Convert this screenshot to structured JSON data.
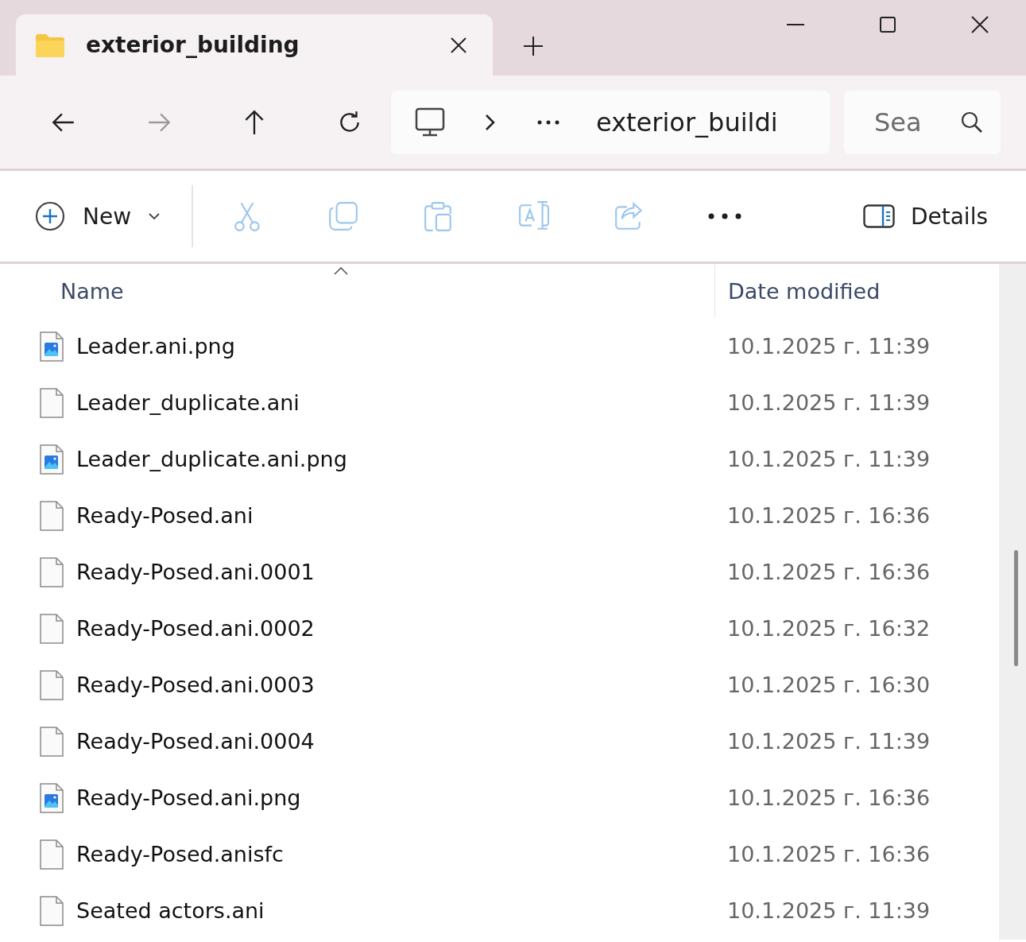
{
  "tab": {
    "title": "exterior_building"
  },
  "nav_buttons": [
    {
      "kind": "back",
      "disabled": false
    },
    {
      "kind": "forward",
      "disabled": true
    },
    {
      "kind": "up",
      "disabled": false
    },
    {
      "kind": "refresh",
      "disabled": false
    }
  ],
  "address": {
    "current": "exterior_buildi"
  },
  "search": {
    "placeholder": "Sea"
  },
  "new_button": {
    "label": "New"
  },
  "toolbar": [
    {
      "kind": "cut",
      "disabled": true
    },
    {
      "kind": "copy",
      "disabled": true
    },
    {
      "kind": "paste",
      "disabled": true
    },
    {
      "kind": "rename",
      "disabled": true
    },
    {
      "kind": "share",
      "disabled": true
    },
    {
      "kind": "more",
      "disabled": false
    }
  ],
  "details_button": {
    "label": "Details"
  },
  "columns": [
    {
      "label": "Name",
      "sorted": true
    },
    {
      "label": "Date modified",
      "sorted": false
    }
  ],
  "files": [
    {
      "name": "Leader.ani.png",
      "kind": "image",
      "date": "10.1.2025 г. 11:39"
    },
    {
      "name": "Leader_duplicate.ani",
      "kind": "file",
      "date": "10.1.2025 г. 11:39"
    },
    {
      "name": "Leader_duplicate.ani.png",
      "kind": "image",
      "date": "10.1.2025 г. 11:39"
    },
    {
      "name": "Ready-Posed.ani",
      "kind": "file",
      "date": "10.1.2025 г. 16:36"
    },
    {
      "name": "Ready-Posed.ani.0001",
      "kind": "file",
      "date": "10.1.2025 г. 16:36"
    },
    {
      "name": "Ready-Posed.ani.0002",
      "kind": "file",
      "date": "10.1.2025 г. 16:32"
    },
    {
      "name": "Ready-Posed.ani.0003",
      "kind": "file",
      "date": "10.1.2025 г. 16:30"
    },
    {
      "name": "Ready-Posed.ani.0004",
      "kind": "file",
      "date": "10.1.2025 г. 11:39"
    },
    {
      "name": "Ready-Posed.ani.png",
      "kind": "image",
      "date": "10.1.2025 г. 16:36"
    },
    {
      "name": "Ready-Posed.anisfc",
      "kind": "file",
      "date": "10.1.2025 г. 16:36"
    },
    {
      "name": "Seated actors.ani",
      "kind": "file",
      "date": "10.1.2025 г. 11:39"
    }
  ]
}
